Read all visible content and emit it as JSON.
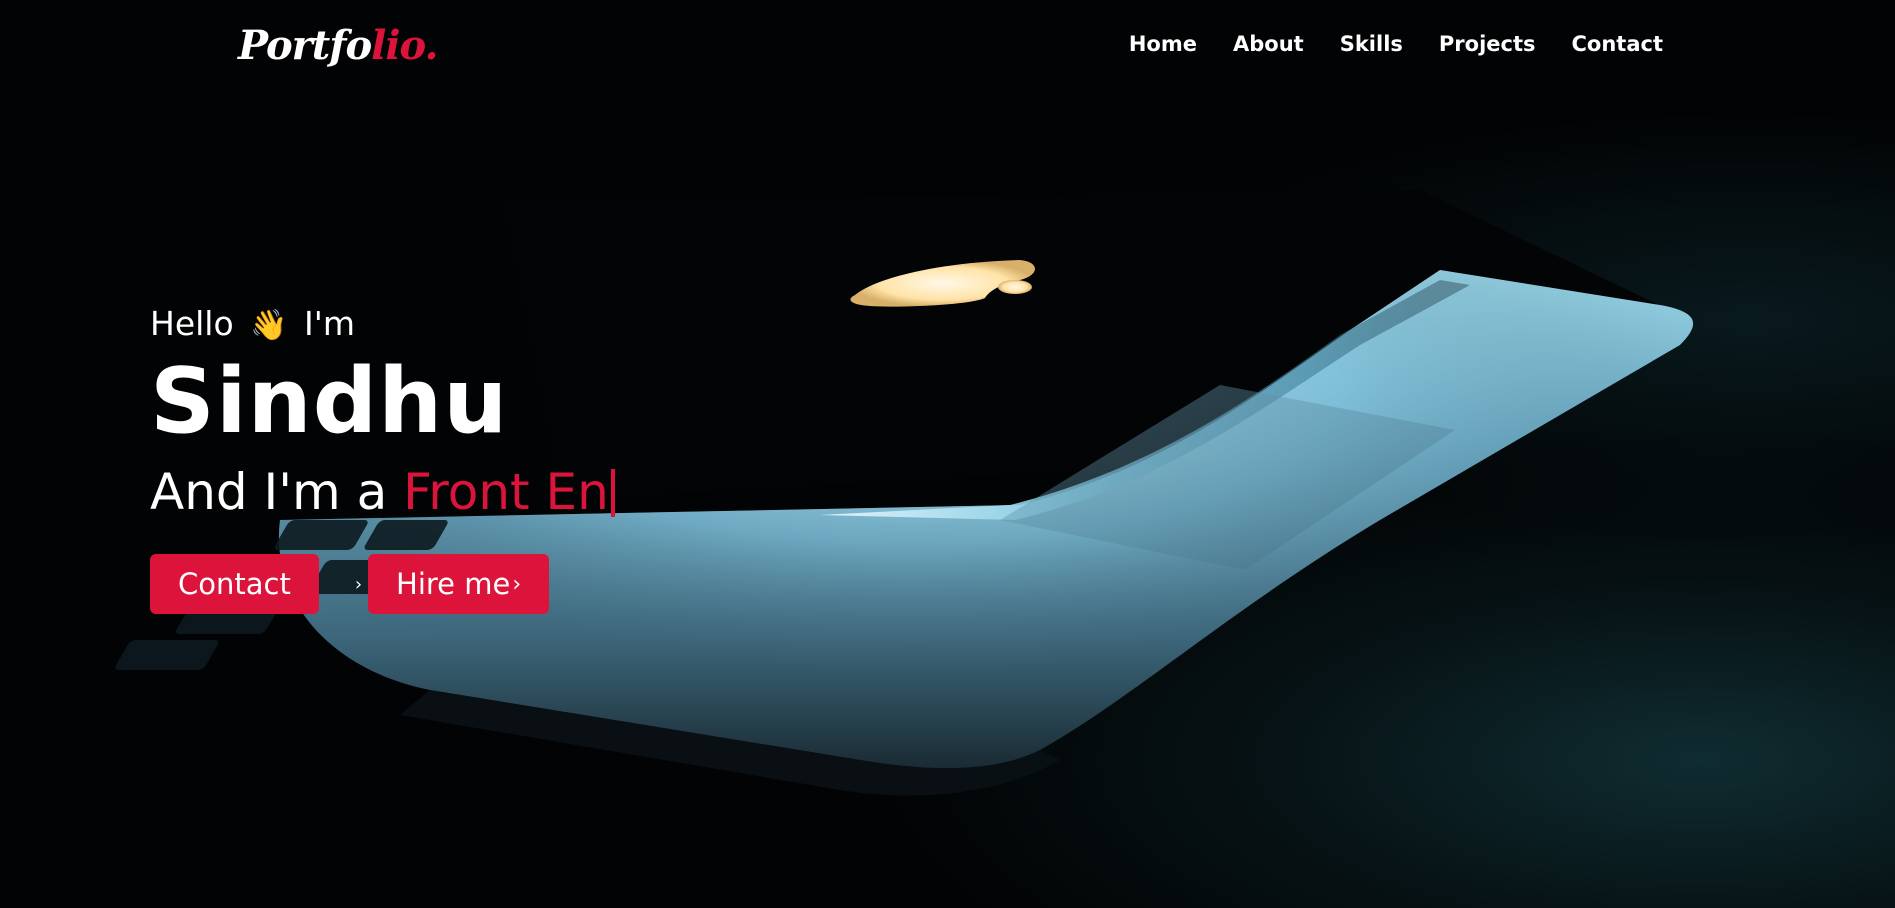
{
  "brand": {
    "logo_main": "Portfo",
    "logo_accent": "lio.",
    "accent_color": "#dc143c"
  },
  "nav": {
    "items": [
      {
        "label": "Home"
      },
      {
        "label": "About"
      },
      {
        "label": "Skills"
      },
      {
        "label": "Projects"
      },
      {
        "label": "Contact"
      }
    ]
  },
  "hero": {
    "greeting_before": "Hello",
    "greeting_emoji": "👋",
    "greeting_after": "I'm",
    "name": "Sindhu",
    "role_prefix": "And I'm a",
    "role_typed": "Front En",
    "buttons": {
      "contact_label": "Contact",
      "hire_label": "Hire me",
      "hire_icon": "chevron-right-icon"
    }
  }
}
